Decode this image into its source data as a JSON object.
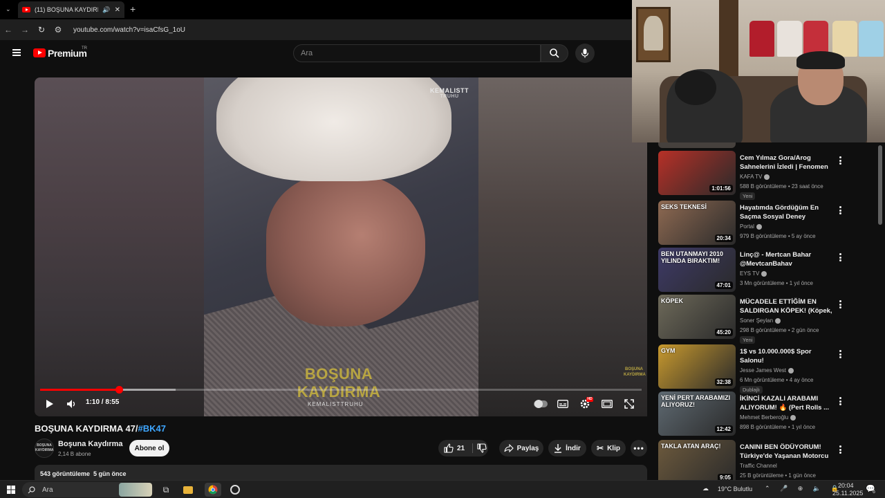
{
  "browser": {
    "tab_title": "(11) BOŞUNA KAYDIRMA 47",
    "url": "youtube.com/watch?v=isaCfsG_1oU"
  },
  "header": {
    "logo": "Premium",
    "region": "TR",
    "search_placeholder": "Ara"
  },
  "video": {
    "watermark_top": "KEMALISTT",
    "watermark_top2": "TRUHU",
    "watermark_big": "BOŞUNA KAYDIRMA",
    "watermark_bottom": "KEMALISTTRUHU",
    "watermark_corner": "BOŞUNA KAYDIRMA",
    "time": "1:10 / 8:55",
    "progress": 0.131,
    "title_main": "BOŞUNA KAYDIRMA 47/",
    "title_tag": "#BK47",
    "channel_name": "Boşuna Kaydırma",
    "channel_avatar": "BOŞUNA KAYDIRMA",
    "channel_subs": "2,14 B abone",
    "subscribe_label": "Abone ol",
    "likes": "21",
    "share_label": "Paylaş",
    "download_label": "İndir",
    "clip_label": "Klip",
    "views_line": "543 görüntüleme  5 gün önce"
  },
  "recommendations": [
    {
      "thumb_text": "",
      "title": "Cem Yılmaz Gora/Arog Sahnelerini İzledi | Fenomen ...",
      "channel": "KAFA TV",
      "verified": true,
      "meta": "588 B görüntüleme • 23 saat önce",
      "badge": "Yeni",
      "duration": "1:01:56",
      "color": "#b73027"
    },
    {
      "thumb_text": "SEKS TEKNESİ",
      "title": "Hayatımda Gördüğüm En Saçma Sosyal Deney",
      "channel": "Portal",
      "verified": true,
      "meta": "979 B görüntüleme • 5 ay önce",
      "badge": "",
      "duration": "20:34",
      "color": "#8f6a52"
    },
    {
      "thumb_text": "BEN UTANMAYI 2010 YILINDA BIRAKTIM!",
      "title": "Linç@ - Mertcan Bahar @MevtcanBahav",
      "channel": "EYS TV",
      "verified": true,
      "meta": "3 Mn görüntüleme • 1 yıl önce",
      "badge": "",
      "duration": "47:01",
      "color": "#3e3a68"
    },
    {
      "thumb_text": "KÖPEK",
      "title": "MÜCADELE ETTİĞİM EN SALDIRGAN KÖPEK! (Köpek, ...",
      "channel": "Soner Şeylan",
      "verified": true,
      "meta": "298 B görüntüleme • 2 gün önce",
      "badge": "Yeni",
      "duration": "45:20",
      "color": "#6e6a5a"
    },
    {
      "thumb_text": "GYM",
      "title": "1$ vs 10.000.000$ Spor Salonu!",
      "channel": "Jesse James West",
      "verified": true,
      "meta": "6 Mn görüntüleme • 4 ay önce",
      "badge": "Dublajlı",
      "duration": "32:38",
      "color": "#c99a2e"
    },
    {
      "thumb_text": "YENİ PERT ARABAMIZI ALIYORUZ!",
      "title": "İKİNCİ KAZALI ARABAMI ALIYORUM! 🔥 (Pert Rolls ...",
      "channel": "Mehmet Berberoğlu",
      "verified": true,
      "meta": "898 B görüntüleme • 1 yıl önce",
      "badge": "",
      "duration": "12:42",
      "color": "#5f6a72"
    },
    {
      "thumb_text": "TAKLA ATAN ARAÇ!",
      "title": "CANINI BEN ÖDÜYORUM! Türkiye'de Yaşanan Motorcu ...",
      "channel": "Traffic Channel",
      "verified": false,
      "meta": "25 B görüntüleme • 1 gün önce",
      "badge": "",
      "duration": "9:05",
      "color": "#6d5a3d"
    }
  ],
  "taskbar": {
    "search_label": "Ara",
    "weather": "19°C  Bulutlu",
    "time": "20:04",
    "date": "25.11.2025",
    "notifications": "6"
  },
  "colors": {
    "accent": "#ff0000",
    "link": "#3ea6ff"
  }
}
